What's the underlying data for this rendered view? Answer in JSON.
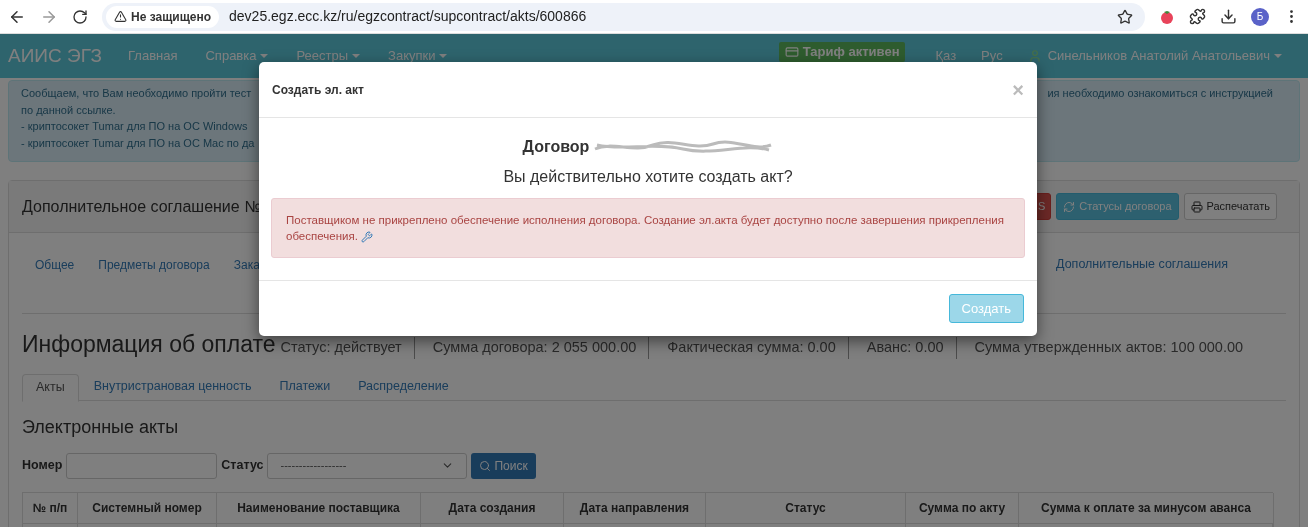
{
  "browser": {
    "security_label": "Не защищено",
    "url": "dev25.egz.ecc.kz/ru/egzcontract/supcontract/akts/600866",
    "profile_initial": "Б"
  },
  "navbar": {
    "brand": "АИИС ЭГЗ",
    "items": [
      {
        "label": "Главная",
        "dropdown": false
      },
      {
        "label": "Справка",
        "dropdown": true
      },
      {
        "label": "Реестры",
        "dropdown": true
      },
      {
        "label": "Закупки",
        "dropdown": true
      }
    ],
    "tariff_badge": "Тариф активен",
    "languages": [
      "Қаз",
      "Рус"
    ],
    "user": "Синельников Анатолий Анатольевич"
  },
  "notice": {
    "lines": [
      {
        "left": "Сообщаем, что Вам необходимо пройти тест",
        "right": "ия необходимо ознакомиться с инструкцией"
      },
      {
        "left": "по данной ссылке."
      },
      {
        "left": "- криптосокет Tumar для ПО на ОС Windows"
      },
      {
        "left": "- криптосокет Tumar для ПО на ОС Mac по да"
      }
    ]
  },
  "agreement_panel": {
    "title": "Дополнительное соглашение №",
    "buttons": [
      {
        "label": "S",
        "kind": "danger"
      },
      {
        "label": "Статусы договора",
        "kind": "info"
      },
      {
        "label": "Распечатать",
        "kind": "print"
      }
    ],
    "tabs": [
      "Общее",
      "Предметы договора",
      "Зака"
    ],
    "end_tabs": [
      "Дополнительные соглашения"
    ]
  },
  "payment_info": {
    "title": "Информация об оплате",
    "stats": [
      "Статус: действует",
      "Сумма договора: 2 055 000.00",
      "Фактическая сумма: 0.00",
      "Аванс: 0.00",
      "Сумма утвержденных актов: 100 000.00"
    ],
    "tabs": [
      {
        "label": "Акты",
        "selected": true
      },
      {
        "label": "Внутристрановая ценность",
        "selected": false
      },
      {
        "label": "Платежи",
        "selected": false
      },
      {
        "label": "Распределение",
        "selected": false
      }
    ]
  },
  "acts": {
    "title": "Электронные акты",
    "filters": {
      "number_label": "Номер",
      "status_label": "Статус",
      "status_value": "------------------",
      "search_button": "Поиск"
    },
    "table": {
      "columns": [
        "№ п/п",
        "Системный номер",
        "Наименование поставщика",
        "Дата создания",
        "Дата направления",
        "Статус",
        "Сумма по акту",
        "Сумма к оплате за минусом аванса"
      ]
    }
  },
  "modal": {
    "title": "Создать эл. акт",
    "close": "×",
    "contract_label": "Договор",
    "question": "Вы действительно хотите создать акт?",
    "alert": "Поставщиком не прикреплено обеспечение исполнения договора. Создание эл.акта будет доступно после завершения прикрепления обеспечения.",
    "submit": {
      "label": "Создать",
      "disabled": true
    }
  }
}
